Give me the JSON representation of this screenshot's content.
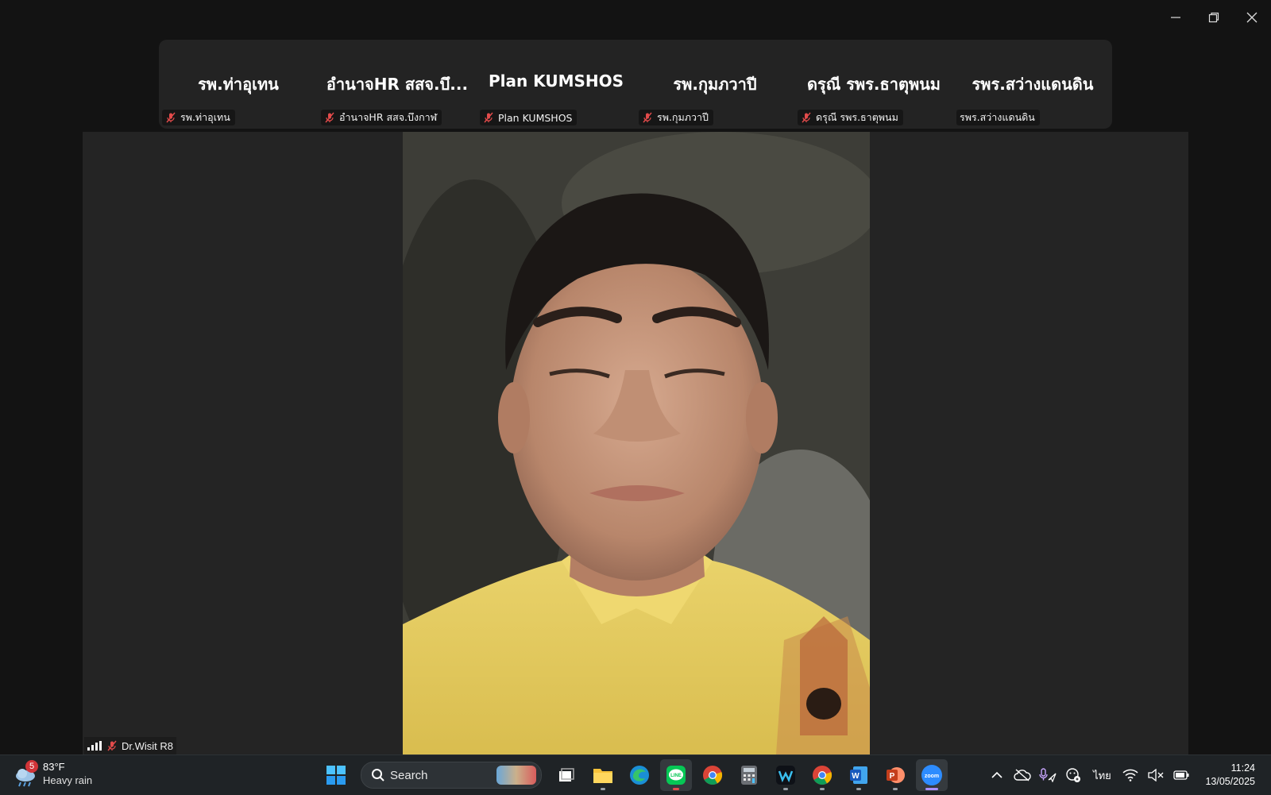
{
  "window": {
    "controls": {
      "minimize": "minimize-icon",
      "restore": "restore-icon",
      "close": "close-icon"
    }
  },
  "participants": [
    {
      "display_name": "รพ.ท่าอุเทน",
      "label": "รพ.ท่าอุเทน",
      "muted": true
    },
    {
      "display_name": "อำนาจHR สสจ.บึ...",
      "label": "อำนาจHR สสจ.บึงกาฬ",
      "muted": true
    },
    {
      "display_name": "Plan KUMSHOS",
      "label": "Plan KUMSHOS",
      "muted": true
    },
    {
      "display_name": "รพ.กุมภวาปี",
      "label": "รพ.กุมภวาปี",
      "muted": true
    },
    {
      "display_name": "ดรุณี รพร.ธาตุพนม",
      "label": "ดรุณี รพร.ธาตุพนม",
      "muted": true
    },
    {
      "display_name": "รพร.สว่างแดนดิน",
      "label": "รพร.สว่างแดนดิน",
      "muted": false
    }
  ],
  "active_speaker": {
    "label": "Dr.Wisit R8",
    "muted": true
  },
  "taskbar": {
    "weather": {
      "badge": "5",
      "temp": "83°F",
      "condition": "Heavy rain"
    },
    "search_label": "Search",
    "apps": [
      "windows-start-icon",
      "task-view-icon",
      "file-explorer-icon",
      "edge-icon",
      "line-icon",
      "chrome-icon",
      "calculator-icon",
      "webex-icon",
      "chrome-icon",
      "word-icon",
      "powerpoint-icon",
      "zoom-icon"
    ],
    "language": "ไทย",
    "time": "11:24",
    "date": "13/05/2025"
  }
}
